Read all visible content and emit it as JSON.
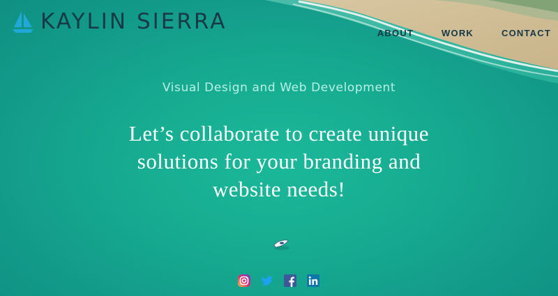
{
  "brand": {
    "name": "KAYLIN SIERRA",
    "accent": "#1fa8d8",
    "text_color": "#183a47"
  },
  "nav": {
    "items": [
      {
        "label": "ABOUT"
      },
      {
        "label": "WORK"
      },
      {
        "label": "CONTACT"
      }
    ]
  },
  "hero": {
    "tagline": "Visual Design and Web Development",
    "headline": "Let’s collaborate to create unique solutions for your branding and website needs!",
    "background_color": "#17ad92"
  },
  "social": {
    "icons": [
      "instagram-icon",
      "twitter-icon",
      "facebook-icon",
      "linkedin-icon"
    ]
  }
}
